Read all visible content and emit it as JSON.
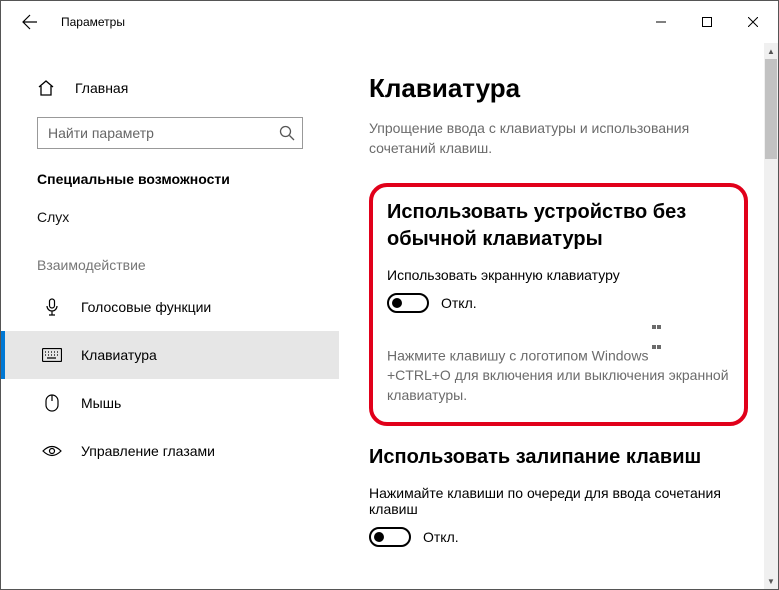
{
  "window": {
    "title": "Параметры",
    "minimize": "–",
    "maximize": "☐",
    "close": "✕"
  },
  "sidebar": {
    "home": "Главная",
    "search_placeholder": "Найти параметр",
    "section": "Специальные возможности",
    "hearing_label": "Слух",
    "group_label": "Взаимодействие",
    "items": [
      {
        "label": "Голосовые функции"
      },
      {
        "label": "Клавиатура"
      },
      {
        "label": "Мышь"
      },
      {
        "label": "Управление глазами"
      }
    ]
  },
  "content": {
    "title": "Клавиатура",
    "subtitle": "Упрощение ввода с клавиатуры и использования сочетаний клавиш.",
    "section1": {
      "title": "Использовать устройство без обычной клавиатуры",
      "setting_label": "Использовать экранную клавиатуру",
      "toggle_state": "Откл.",
      "hint_pre": "Нажмите клавишу с логотипом Windows ",
      "hint_post": " +CTRL+O для включения или выключения экранной клавиатуры."
    },
    "section2": {
      "title": "Использовать залипание клавиш",
      "setting_label": "Нажимайте клавиши по очереди для ввода сочетания клавиш",
      "toggle_state": "Откл."
    }
  }
}
